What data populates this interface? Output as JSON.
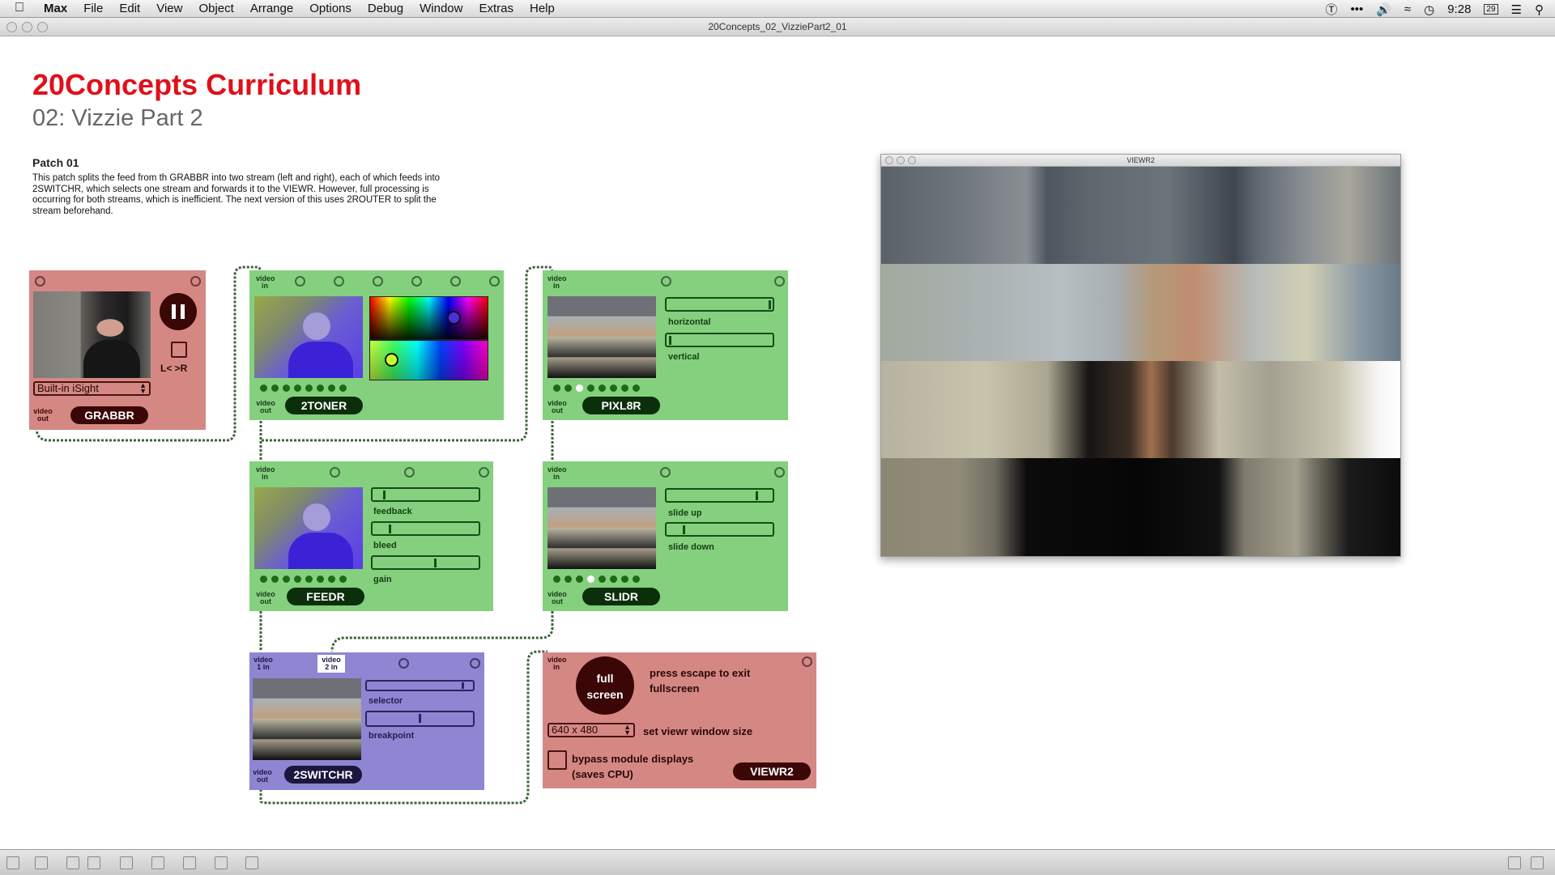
{
  "menubar": {
    "apple_icon": "apple-logo-icon",
    "app": "Max",
    "items": [
      "File",
      "Edit",
      "View",
      "Object",
      "Arrange",
      "Options",
      "Debug",
      "Window",
      "Extras",
      "Help"
    ],
    "clock": "9:28",
    "status_icons": [
      "sync-icon",
      "more-icon",
      "volume-icon",
      "wifi-icon",
      "time-machine-icon",
      "calendar-icon",
      "list-icon",
      "spotlight-icon"
    ],
    "calendar_day": "29"
  },
  "window": {
    "title": "20Concepts_02_VizziePart2_01"
  },
  "header": {
    "title": "20Concepts Curriculum",
    "subtitle": "02: Vizzie Part 2",
    "patch_heading": "Patch 01",
    "description": "This patch splits the feed from th GRABBR into two stream (left and right), each of which feeds into 2SWITCHR, which selects one stream and forwards it to  the VIEWR. However, full processing is occurring for both streams, which is inefficient. The next version of this uses 2ROUTER to split the stream beforehand."
  },
  "modules": {
    "grabbr": {
      "name": "GRABBR",
      "device": "Built-in iSight",
      "toggle_label": "L< >R",
      "out_label": "video out"
    },
    "toner": {
      "name": "2TONER",
      "in_label": "video in",
      "out_label": "video out"
    },
    "pixl8r": {
      "name": "PIXL8R",
      "in_label": "video in",
      "out_label": "video out",
      "slider1": "horizontal",
      "slider2": "vertical",
      "slider1_value": 0.97,
      "slider2_value": 0.03
    },
    "feedr": {
      "name": "FEEDR",
      "in_label": "video in",
      "out_label": "video out",
      "slider1": "feedback",
      "slider2": "bleed",
      "slider3": "gain",
      "slider1_value": 0.1,
      "slider2_value": 0.15,
      "slider3_value": 0.58
    },
    "slidr": {
      "name": "SLIDR",
      "in_label": "video in",
      "out_label": "video out",
      "slider1": "slide up",
      "slider2": "slide down",
      "slider1_value": 0.85,
      "slider2_value": 0.15
    },
    "switchr": {
      "name": "2SWITCHR",
      "in1_label": "video 1 in",
      "in2_label": "video 2 in",
      "out_label": "video out",
      "slider1": "selector",
      "slider2": "breakpoint",
      "slider1_value": 0.96,
      "slider2_value": 0.5
    },
    "viewr": {
      "name": "VIEWR2",
      "in_label": "video in",
      "fullscreen_label": "full screen",
      "escape_text": "press escape to exit fullscreen",
      "size": "640 x 480",
      "size_label": "set viewr window size",
      "bypass_label": "bypass module displays (saves CPU)"
    }
  },
  "viewer_window": {
    "title": "VIEWR2"
  },
  "colors": {
    "accent_red": "#e0101b",
    "module_green": "#84d07f",
    "module_red": "#d58883",
    "module_purple": "#8e85d3"
  }
}
